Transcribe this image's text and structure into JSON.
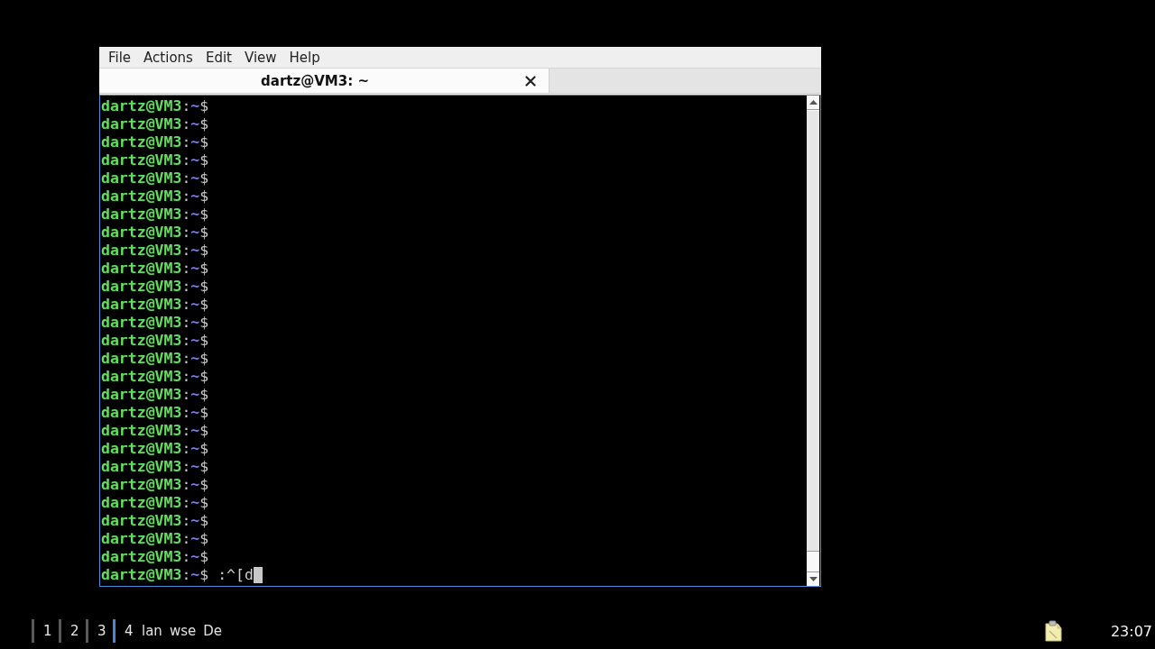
{
  "window": {
    "menu": [
      "File",
      "Actions",
      "Edit",
      "View",
      "Help"
    ],
    "tabs": [
      {
        "title": "dartz@VM3: ~",
        "selected": true
      }
    ]
  },
  "terminal": {
    "lines": [
      {
        "user_host": "dartz@VM3",
        "separator": ":",
        "path": "~",
        "symbol": "$",
        "cursor": false
      },
      {
        "user_host": "dartz@VM3",
        "separator": ":",
        "path": "~",
        "symbol": "$",
        "cursor": false
      },
      {
        "user_host": "dartz@VM3",
        "separator": ":",
        "path": "~",
        "symbol": "$",
        "cursor": false
      },
      {
        "user_host": "dartz@VM3",
        "separator": ":",
        "path": "~",
        "symbol": "$",
        "cursor": false
      },
      {
        "user_host": "dartz@VM3",
        "separator": ":",
        "path": "~",
        "symbol": "$",
        "cursor": false
      },
      {
        "user_host": "dartz@VM3",
        "separator": ":",
        "path": "~",
        "symbol": "$",
        "cursor": false
      },
      {
        "user_host": "dartz@VM3",
        "separator": ":",
        "path": "~",
        "symbol": "$",
        "cursor": false
      },
      {
        "user_host": "dartz@VM3",
        "separator": ":",
        "path": "~",
        "symbol": "$",
        "cursor": false
      },
      {
        "user_host": "dartz@VM3",
        "separator": ":",
        "path": "~",
        "symbol": "$",
        "cursor": false
      },
      {
        "user_host": "dartz@VM3",
        "separator": ":",
        "path": "~",
        "symbol": "$",
        "cursor": false
      },
      {
        "user_host": "dartz@VM3",
        "separator": ":",
        "path": "~",
        "symbol": "$",
        "cursor": false
      },
      {
        "user_host": "dartz@VM3",
        "separator": ":",
        "path": "~",
        "symbol": "$",
        "cursor": false
      },
      {
        "user_host": "dartz@VM3",
        "separator": ":",
        "path": "~",
        "symbol": "$",
        "cursor": false
      },
      {
        "user_host": "dartz@VM3",
        "separator": ":",
        "path": "~",
        "symbol": "$",
        "cursor": false
      },
      {
        "user_host": "dartz@VM3",
        "separator": ":",
        "path": "~",
        "symbol": "$",
        "cursor": false
      },
      {
        "user_host": "dartz@VM3",
        "separator": ":",
        "path": "~",
        "symbol": "$",
        "cursor": false
      },
      {
        "user_host": "dartz@VM3",
        "separator": ":",
        "path": "~",
        "symbol": "$",
        "cursor": false
      },
      {
        "user_host": "dartz@VM3",
        "separator": ":",
        "path": "~",
        "symbol": "$",
        "cursor": false
      },
      {
        "user_host": "dartz@VM3",
        "separator": ":",
        "path": "~",
        "symbol": "$",
        "cursor": false
      },
      {
        "user_host": "dartz@VM3",
        "separator": ":",
        "path": "~",
        "symbol": "$",
        "cursor": false
      },
      {
        "user_host": "dartz@VM3",
        "separator": ":",
        "path": "~",
        "symbol": "$",
        "cursor": false
      },
      {
        "user_host": "dartz@VM3",
        "separator": ":",
        "path": "~",
        "symbol": "$",
        "cursor": false
      },
      {
        "user_host": "dartz@VM3",
        "separator": ":",
        "path": "~",
        "symbol": "$",
        "cursor": false
      },
      {
        "user_host": "dartz@VM3",
        "separator": ":",
        "path": "~",
        "symbol": "$",
        "cursor": false
      },
      {
        "user_host": "dartz@VM3",
        "separator": ":",
        "path": "~",
        "symbol": "$",
        "cursor": false
      },
      {
        "user_host": "dartz@VM3",
        "separator": ":",
        "path": "~",
        "symbol": "$",
        "cursor": false
      },
      {
        "user_host": "dartz@VM3",
        "separator": ":",
        "path": "~",
        "symbol": "$",
        "command": ":^[d",
        "cursor": true
      }
    ]
  },
  "taskbar": {
    "workspaces": [
      {
        "label": "1",
        "selected": false
      },
      {
        "label": "2",
        "selected": false
      },
      {
        "label": "3",
        "selected": false
      },
      {
        "label": "4",
        "selected": true
      }
    ],
    "tasks": [
      "lan",
      "wse",
      "De"
    ],
    "clock": "23:07"
  }
}
